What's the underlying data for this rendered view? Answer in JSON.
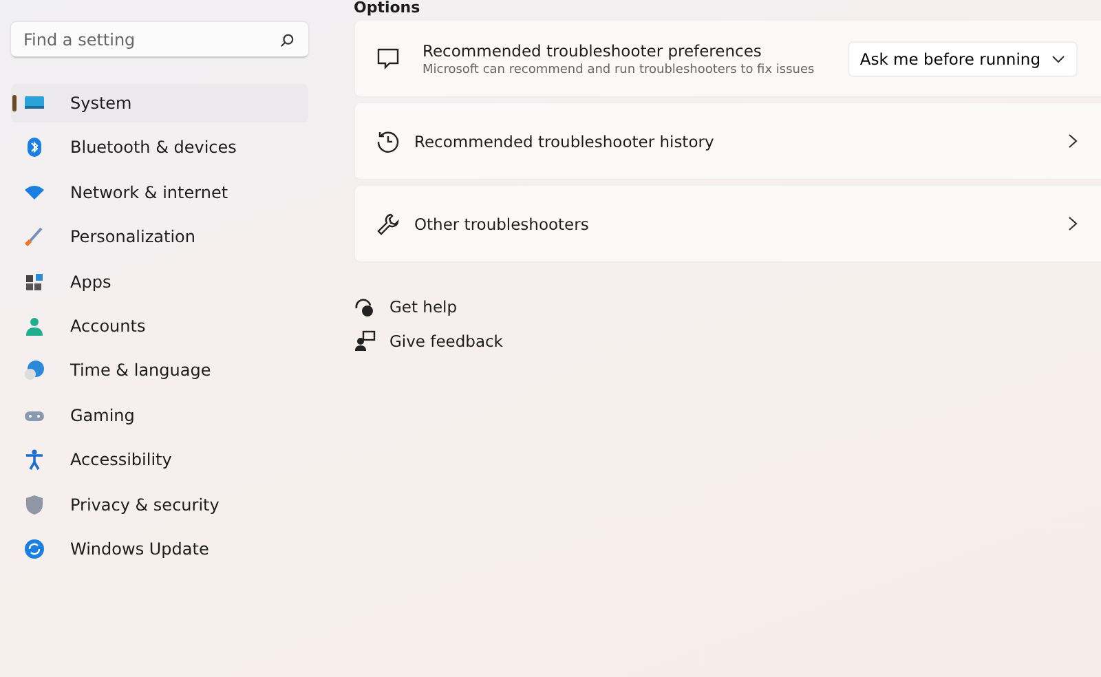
{
  "search": {
    "placeholder": "Find a setting"
  },
  "sidebar": {
    "items": [
      {
        "label": "System",
        "kind": "system",
        "selected": true
      },
      {
        "label": "Bluetooth & devices",
        "kind": "bluetooth",
        "selected": false
      },
      {
        "label": "Network & internet",
        "kind": "network",
        "selected": false
      },
      {
        "label": "Personalization",
        "kind": "brush",
        "selected": false
      },
      {
        "label": "Apps",
        "kind": "apps",
        "selected": false
      },
      {
        "label": "Accounts",
        "kind": "person",
        "selected": false
      },
      {
        "label": "Time & language",
        "kind": "globe",
        "selected": false
      },
      {
        "label": "Gaming",
        "kind": "gamepad",
        "selected": false
      },
      {
        "label": "Accessibility",
        "kind": "access",
        "selected": false
      },
      {
        "label": "Privacy & security",
        "kind": "shield",
        "selected": false
      },
      {
        "label": "Windows Update",
        "kind": "update",
        "selected": false
      }
    ]
  },
  "section_title": "Options",
  "cards": [
    {
      "kind": "dropdown",
      "title": "Recommended troubleshooter preferences",
      "subtitle": "Microsoft can recommend and run troubleshooters to fix issues",
      "value": "Ask me before running"
    },
    {
      "kind": "link",
      "title": "Recommended troubleshooter history"
    },
    {
      "kind": "link",
      "title": "Other troubleshooters"
    }
  ],
  "links": [
    {
      "label": "Get help"
    },
    {
      "label": "Give feedback"
    }
  ]
}
